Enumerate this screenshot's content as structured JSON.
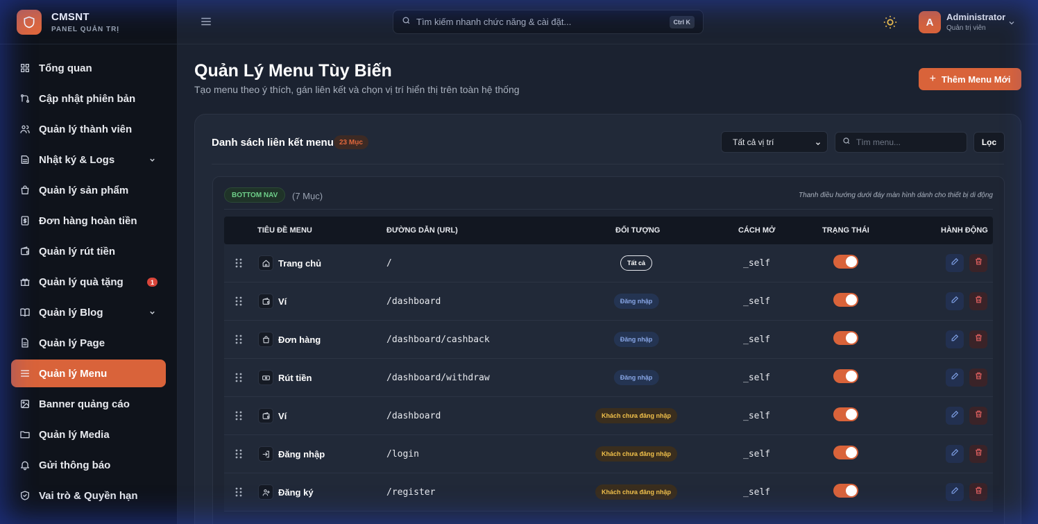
{
  "brand": {
    "name": "CMSNT",
    "subtitle": "PANEL QUẢN TRỊ"
  },
  "sidebar": {
    "items": [
      {
        "label": "Tổng quan",
        "icon": "dashboard-grid-icon"
      },
      {
        "label": "Cập nhật phiên bản",
        "icon": "git-branch-icon"
      },
      {
        "label": "Quản lý thành viên",
        "icon": "users-icon"
      },
      {
        "label": "Nhật ký & Logs",
        "icon": "log-icon",
        "expandable": true
      },
      {
        "label": "Quản lý sản phẩm",
        "icon": "shopping-bag-icon"
      },
      {
        "label": "Đơn hàng hoàn tiền",
        "icon": "dollar-receipt-icon"
      },
      {
        "label": "Quản lý rút tiền",
        "icon": "wallet-icon"
      },
      {
        "label": "Quản lý quà tặng",
        "icon": "gift-icon",
        "badge": "1"
      },
      {
        "label": "Quản lý Blog",
        "icon": "book-icon",
        "expandable": true
      },
      {
        "label": "Quản lý Page",
        "icon": "file-icon"
      },
      {
        "label": "Quản lý Menu",
        "icon": "menu-icon",
        "active": true
      },
      {
        "label": "Banner quảng cáo",
        "icon": "image-icon"
      },
      {
        "label": "Quản lý Media",
        "icon": "folder-icon"
      },
      {
        "label": "Gửi thông báo",
        "icon": "bell-icon"
      },
      {
        "label": "Vai trò & Quyền hạn",
        "icon": "shield-check-icon"
      }
    ]
  },
  "topbar": {
    "search_placeholder": "Tìm kiếm nhanh chức năng & cài đặt...",
    "shortcut": "Ctrl K",
    "user": {
      "initial": "A",
      "name": "Administrator",
      "role": "Quản trị viên"
    }
  },
  "page": {
    "title": "Quản Lý Menu Tùy Biến",
    "subtitle": "Tạo menu theo ý thích, gán liên kết và chọn vị trí hiển thị trên toàn hệ thống",
    "add_button": "Thêm Menu Mới"
  },
  "card": {
    "title": "Danh sách liên kết menu",
    "count": "23 Mục",
    "position_select": "Tất cả vị trí",
    "search_placeholder": "Tìm menu...",
    "filter_button": "Lọc"
  },
  "group": {
    "tag": "BOTTOM NAV",
    "count": "(7 Mục)",
    "note": "Thanh điều hướng dưới đáy màn hình dành cho thiết bị di động"
  },
  "table": {
    "headers": {
      "title": "TIÊU ĐỀ MENU",
      "url": "ĐƯỜNG DẪN (URL)",
      "audience": "ĐỐI TƯỢNG",
      "target": "CÁCH MỞ",
      "status": "TRẠNG THÁI",
      "actions": "HÀNH ĐỘNG"
    },
    "rows": [
      {
        "title": "Trang chủ",
        "icon": "home-icon",
        "url": "/",
        "audience": "Tất cả",
        "audience_type": "all",
        "target": "_self",
        "enabled": true
      },
      {
        "title": "Ví",
        "icon": "wallet-icon",
        "url": "/dashboard",
        "audience": "Đăng nhập",
        "audience_type": "login",
        "target": "_self",
        "enabled": true
      },
      {
        "title": "Đơn hàng",
        "icon": "shopping-bag-icon",
        "url": "/dashboard/cashback",
        "audience": "Đăng nhập",
        "audience_type": "login",
        "target": "_self",
        "enabled": true
      },
      {
        "title": "Rút tiền",
        "icon": "cash-icon",
        "url": "/dashboard/withdraw",
        "audience": "Đăng nhập",
        "audience_type": "login",
        "target": "_self",
        "enabled": true
      },
      {
        "title": "Ví",
        "icon": "wallet-icon",
        "url": "/dashboard",
        "audience": "Khách chưa đăng nhập",
        "audience_type": "guest",
        "target": "_self",
        "enabled": true
      },
      {
        "title": "Đăng nhập",
        "icon": "login-icon",
        "url": "/login",
        "audience": "Khách chưa đăng nhập",
        "audience_type": "guest",
        "target": "_self",
        "enabled": true
      },
      {
        "title": "Đăng ký",
        "icon": "user-plus-icon",
        "url": "/register",
        "audience": "Khách chưa đăng nhập",
        "audience_type": "guest",
        "target": "_self",
        "enabled": true
      }
    ]
  },
  "colors": {
    "accent": "#d9633a",
    "bg": "#1b2230",
    "sidebar": "#0f131b",
    "card": "#212938"
  }
}
